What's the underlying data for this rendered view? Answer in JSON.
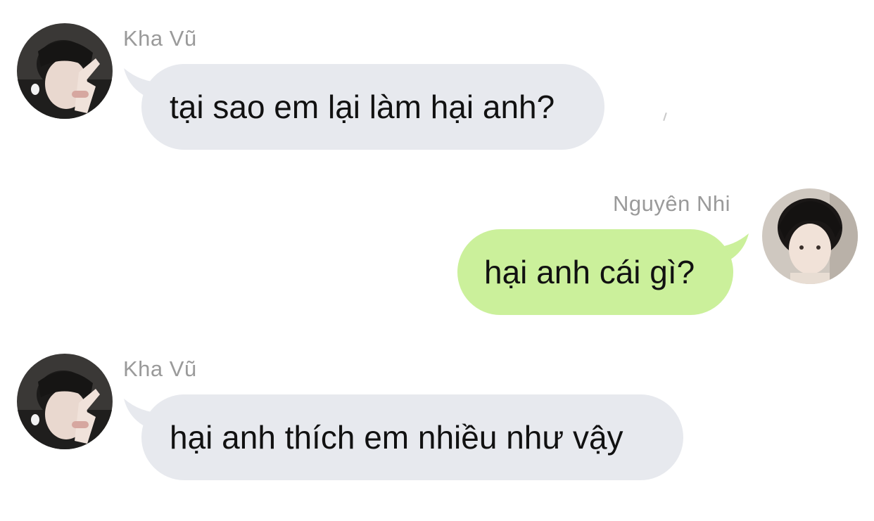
{
  "messages": [
    {
      "sender": "Kha Vũ",
      "text": "tại sao em lại làm hại anh?",
      "direction": "incoming",
      "avatar_icon": "avatar-kha-vu"
    },
    {
      "sender": "Nguyên Nhi",
      "text": "hại anh cái gì?",
      "direction": "outgoing",
      "avatar_icon": "avatar-nguyen-nhi"
    },
    {
      "sender": "Kha Vũ",
      "text": "hại anh thích em nhiều như vậy",
      "direction": "incoming",
      "avatar_icon": "avatar-kha-vu"
    }
  ],
  "colors": {
    "incoming_bubble": "#e7e9ee",
    "outgoing_bubble": "#cbf09b",
    "sender_name": "#9a9a9a",
    "message_text": "#111111"
  }
}
